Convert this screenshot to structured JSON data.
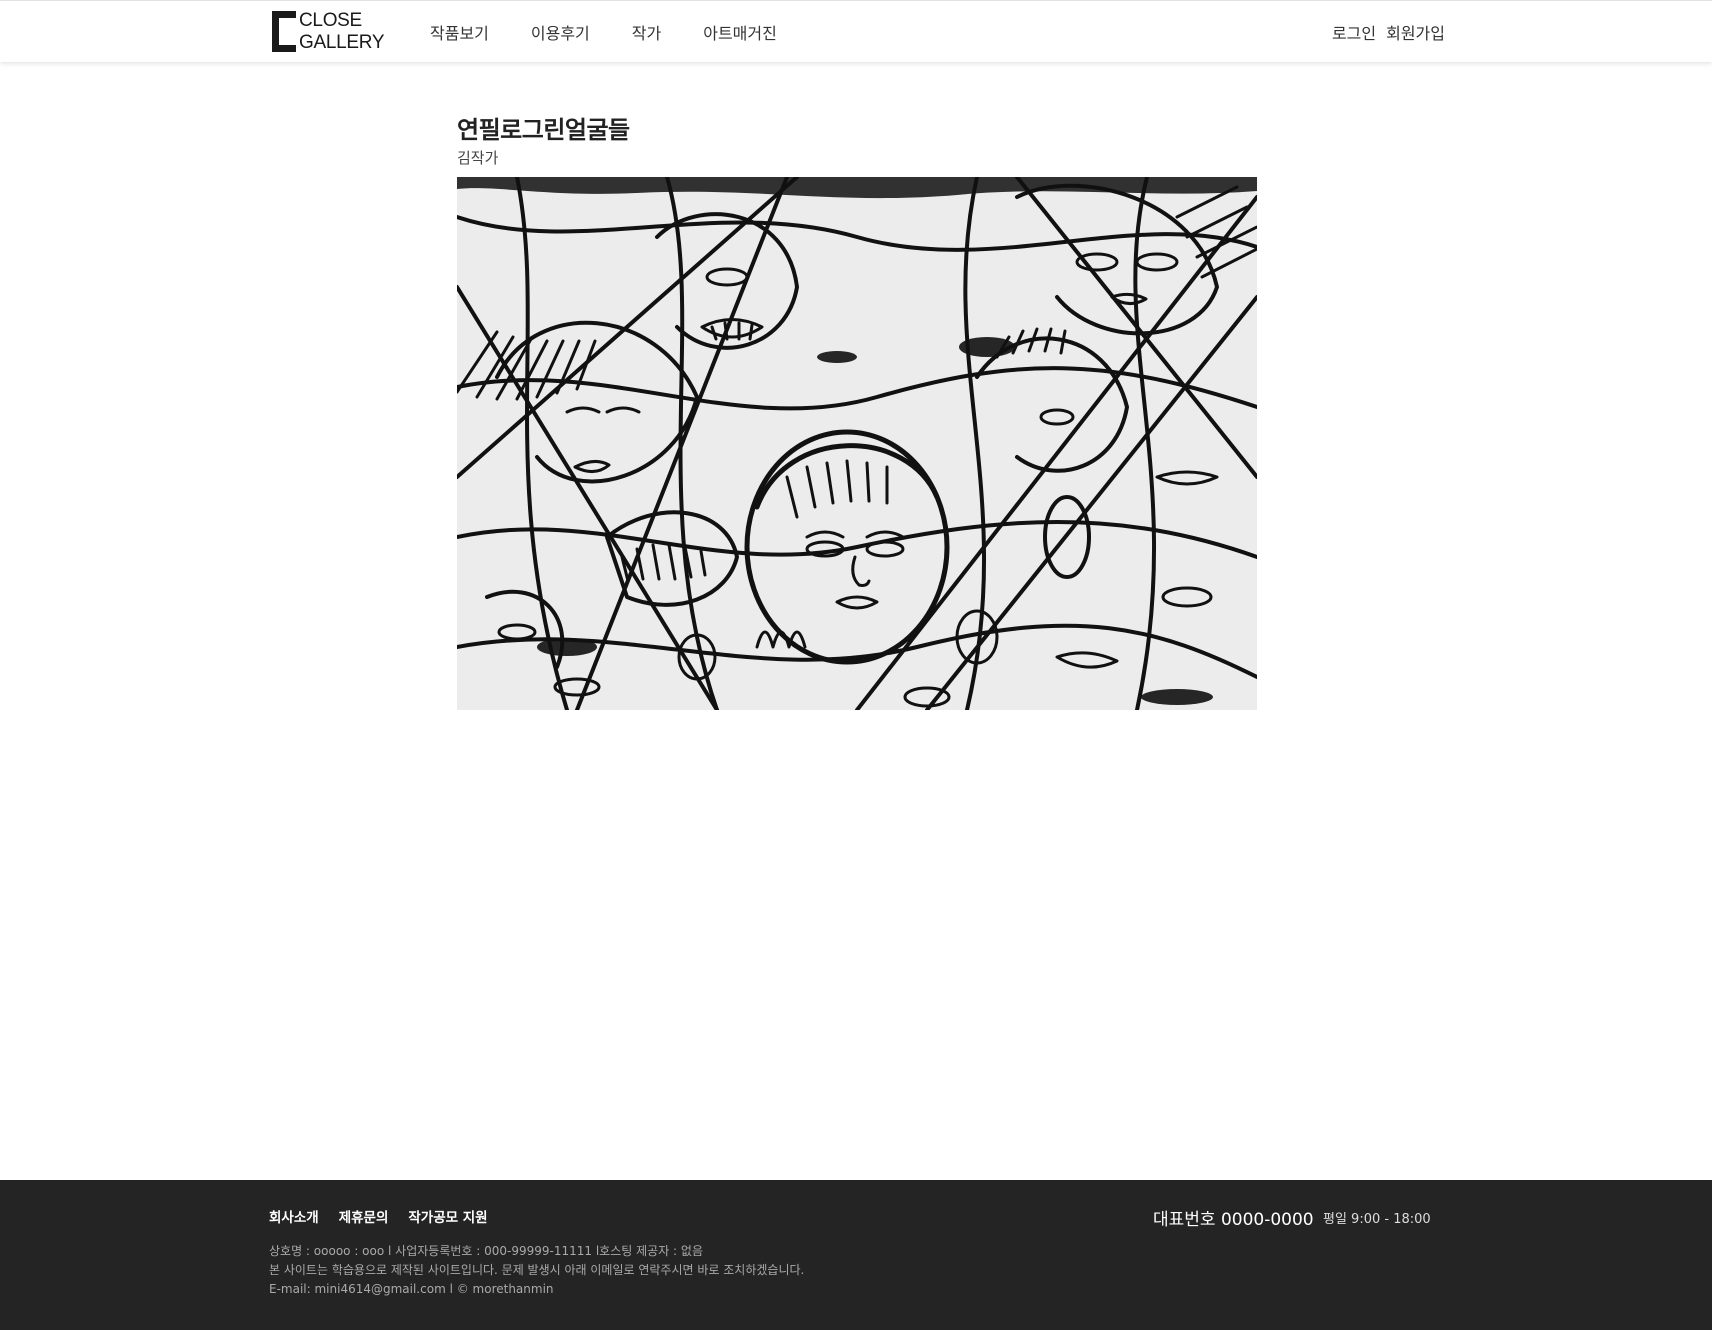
{
  "header": {
    "logo": {
      "line1": "CLOSE",
      "line2": "GALLERY"
    },
    "nav": [
      "작품보기",
      "이용후기",
      "작가",
      "아트매거진"
    ],
    "auth": {
      "login": "로그인",
      "signup": "회원가입"
    }
  },
  "main": {
    "title": "연필로그린얼굴들",
    "artist": "김작가",
    "artwork_alt": "연필로그린얼굴들"
  },
  "footer": {
    "links": [
      "회사소개",
      "제휴문의",
      "작가공모 지원"
    ],
    "info": [
      "상호명 : ooooo : ooo l 사업자등록번호 : 000-99999-11111 l호스팅 제공자 : 없음",
      "본 사이트는 학습용으로 제작된 사이트입니다. 문제 발생시 아래 이메일로 연락주시면 바로 조치하겠습니다.",
      "E-mail: mini4614@gmail.com l © morethanmin"
    ],
    "phone": "대표번호 0000-0000",
    "hours": "평일 9:00 - 18:00"
  }
}
